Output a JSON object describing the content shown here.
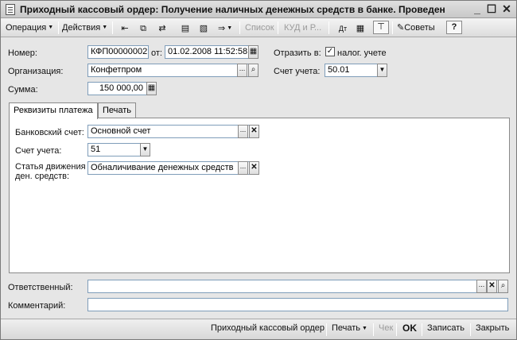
{
  "window": {
    "title": "Приходный кассовый ордер: Получение наличных денежных средств в банке. Проведен",
    "minimize": "_",
    "maximize": "☐",
    "close": "✕"
  },
  "toolbar": {
    "operation": "Операция",
    "actions": "Действия",
    "list": "Список",
    "kudir": "КУД и Р...",
    "tips": "Советы",
    "help": "?"
  },
  "form": {
    "number_label": "Номер:",
    "number_value": "КФП00000002",
    "date_label": "от:",
    "date_value": "01.02.2008 11:52:58",
    "reflect_label": "Отразить в:",
    "tax_accounting_label": "налог. учете",
    "tax_accounting_checked": true,
    "org_label": "Организация:",
    "org_value": "Конфетпром",
    "account_label": "Счет учета:",
    "account_value": "50.01",
    "sum_label": "Сумма:",
    "sum_value": "150 000,00"
  },
  "tabs": [
    {
      "label": "Реквизиты платежа",
      "active": true
    },
    {
      "label": "Печать",
      "active": false
    }
  ],
  "payment": {
    "bank_account_label": "Банковский счет:",
    "bank_account_value": "Основной счет",
    "account_label": "Счет учета:",
    "account_value": "51",
    "cash_flow_label_1": "Статья движения",
    "cash_flow_label_2": "ден. средств:",
    "cash_flow_value": "Обналичивание денежных средств"
  },
  "footer_fields": {
    "responsible_label": "Ответственный:",
    "responsible_value": "",
    "comment_label": "Комментарий:",
    "comment_value": ""
  },
  "bottom": {
    "print_form": "Приходный кассовый ордер",
    "print": "Печать",
    "check": "Чек",
    "ok": "OK",
    "save": "Записать",
    "close": "Закрыть"
  }
}
